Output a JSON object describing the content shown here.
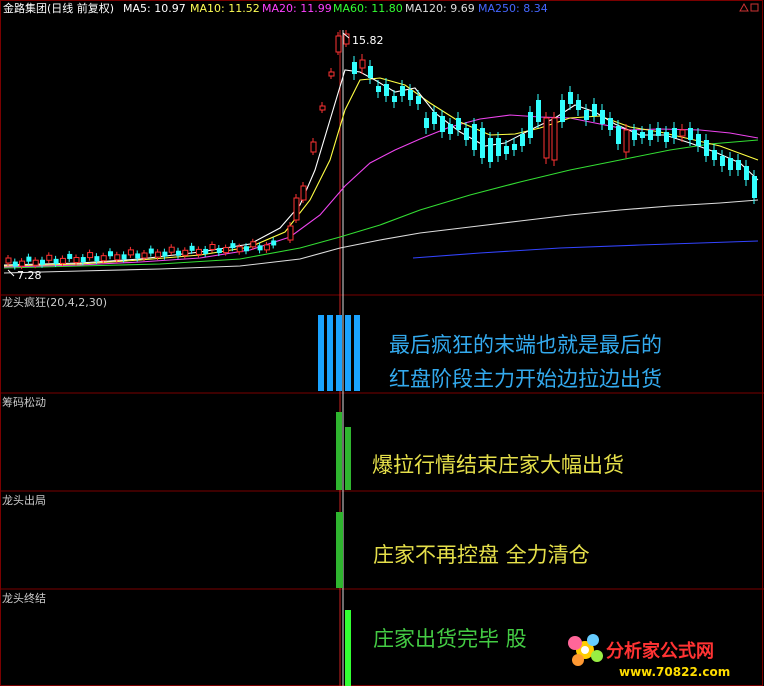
{
  "header": {
    "security": "金路集团(日线 前复权)",
    "ma": [
      {
        "label": "MA5: 10.97",
        "color": "#ffffff"
      },
      {
        "label": "MA10: 11.52",
        "color": "#ffff55"
      },
      {
        "label": "MA20: 11.99",
        "color": "#ff40ff"
      },
      {
        "label": "MA60: 11.80",
        "color": "#33ff33"
      },
      {
        "label": "MA120: 9.69",
        "color": "#dddddd"
      },
      {
        "label": "MA250: 8.34",
        "color": "#4466ff"
      }
    ],
    "corner_icons": [
      "up-triangle-icon",
      "square-icon"
    ]
  },
  "price_chart": {
    "high_label": "15.82",
    "low_label": "7.28"
  },
  "panels": [
    {
      "name": "龙头疯狂(20,4,2,30)",
      "annotation_lines": [
        "最后疯狂的末端也就是最后的",
        "红盘阶段主力开始边拉边出货"
      ],
      "text_color": "#33aaee"
    },
    {
      "name": "筹码松动",
      "annotation_lines": [
        "爆拉行情结束庄家大幅出货"
      ],
      "text_color": "#e6e04a"
    },
    {
      "name": "龙头出局",
      "annotation_lines": [
        "庄家不再控盘  全力清仓"
      ],
      "text_color": "#e6e04a"
    },
    {
      "name": "龙头终结",
      "annotation_lines": [
        "庄家出货完毕  股"
      ],
      "text_color": "#44cc44"
    }
  ],
  "watermark": {
    "text": "分析家公式网",
    "url": "www.70822.com"
  },
  "colors": {
    "grid": "#7a0000",
    "up_candle": "#ff3333",
    "down_candle": "#33ffff",
    "panel1_bars": "#1aa3ff",
    "green_bars": "#2fb52f",
    "bright_green_bars": "#33ff33"
  }
}
